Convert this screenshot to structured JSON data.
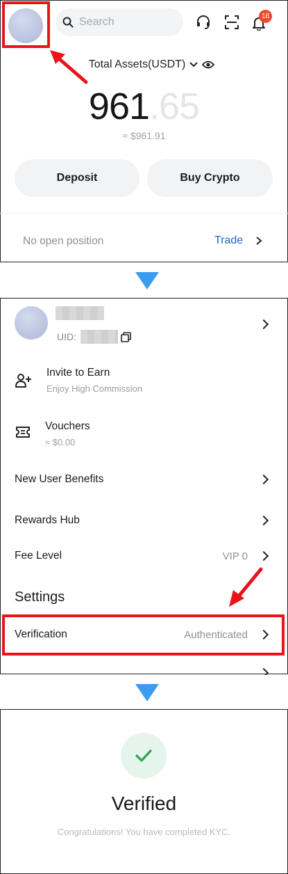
{
  "screen1": {
    "search": {
      "placeholder": "Search"
    },
    "notifications_count": "18",
    "total_assets_label": "Total Assets(USDT)",
    "balance_integer": "961",
    "balance_decimal": ".65",
    "usd_equivalent": "≈ $961.91",
    "deposit_label": "Deposit",
    "buy_crypto_label": "Buy Crypto",
    "no_position_text": "No open position",
    "trade_label": "Trade"
  },
  "screen2": {
    "uid_label": "UID:",
    "menu": [
      {
        "label": "Invite to Earn",
        "sub": "Enjoy High Commission",
        "icon": "add-user-icon"
      },
      {
        "label": "Vouchers",
        "sub": "≈ $0.00",
        "icon": "ticket-icon"
      },
      {
        "label": "New User Benefits"
      },
      {
        "label": "Rewards Hub"
      },
      {
        "label": "Fee Level",
        "value": "VIP 0"
      }
    ],
    "settings_heading": "Settings",
    "verification": {
      "label": "Verification",
      "value": "Authenticated"
    }
  },
  "screen3": {
    "title": "Verified",
    "subtitle": "Congratulations! You have completed KYC."
  },
  "colors": {
    "highlight": "#e8141a",
    "flow_arrow": "#3b9cf0",
    "link": "#2167c8",
    "success": "#2e9e5b",
    "badge": "#f04a2c"
  }
}
